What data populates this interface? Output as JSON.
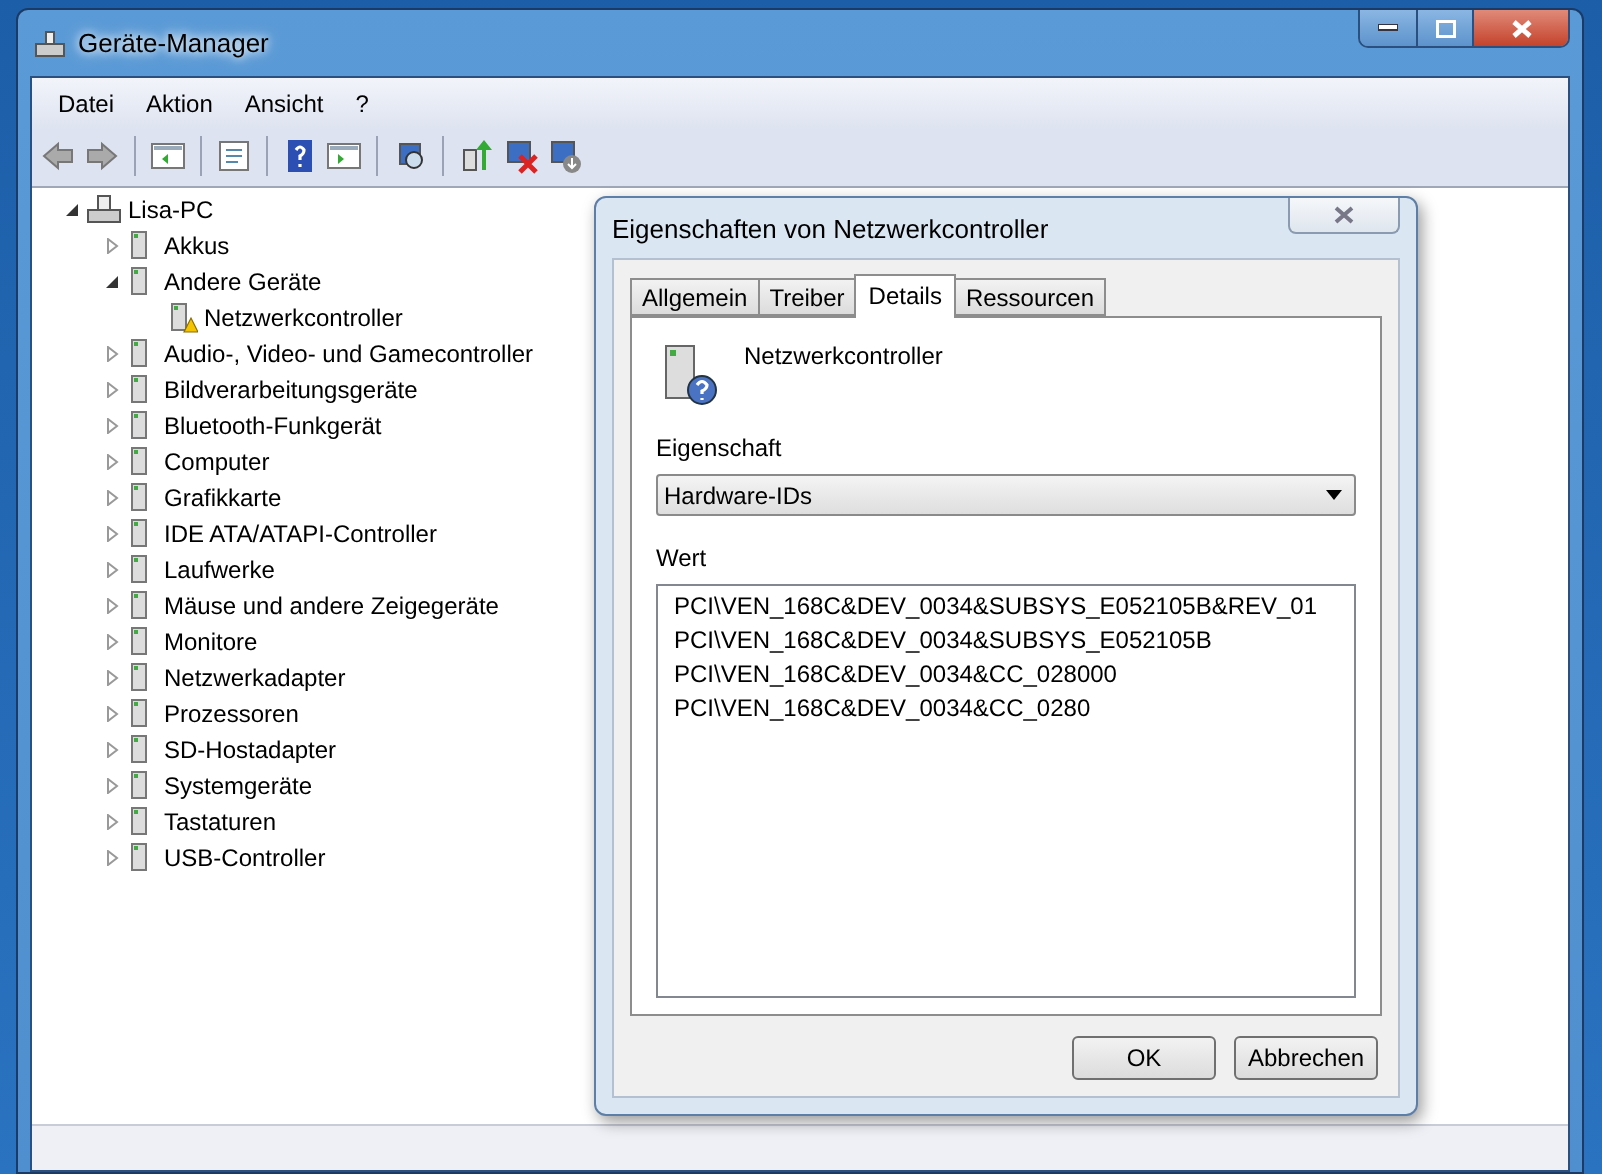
{
  "window": {
    "title": "Geräte-Manager"
  },
  "menu": [
    "Datei",
    "Aktion",
    "Ansicht",
    "?"
  ],
  "tree": {
    "label": "Lisa-PC",
    "expanded": true,
    "children": [
      {
        "label": "Akkus",
        "expanded": false
      },
      {
        "label": "Andere Geräte",
        "expanded": true,
        "children": [
          {
            "label": "Netzwerkcontroller",
            "warning": true
          }
        ]
      },
      {
        "label": "Audio-, Video- und Gamecontroller",
        "expanded": false
      },
      {
        "label": "Bildverarbeitungsgeräte",
        "expanded": false
      },
      {
        "label": "Bluetooth-Funkgerät",
        "expanded": false
      },
      {
        "label": "Computer",
        "expanded": false
      },
      {
        "label": "Grafikkarte",
        "expanded": false
      },
      {
        "label": "IDE ATA/ATAPI-Controller",
        "expanded": false
      },
      {
        "label": "Laufwerke",
        "expanded": false
      },
      {
        "label": "Mäuse und andere Zeigegeräte",
        "expanded": false
      },
      {
        "label": "Monitore",
        "expanded": false
      },
      {
        "label": "Netzwerkadapter",
        "expanded": false
      },
      {
        "label": "Prozessoren",
        "expanded": false
      },
      {
        "label": "SD-Hostadapter",
        "expanded": false
      },
      {
        "label": "Systemgeräte",
        "expanded": false
      },
      {
        "label": "Tastaturen",
        "expanded": false
      },
      {
        "label": "USB-Controller",
        "expanded": false
      }
    ]
  },
  "dialog": {
    "title": "Eigenschaften von Netzwerkcontroller",
    "tabs": [
      {
        "label": "Allgemein",
        "selected": false
      },
      {
        "label": "Treiber",
        "selected": false
      },
      {
        "label": "Details",
        "selected": true
      },
      {
        "label": "Ressourcen",
        "selected": false
      }
    ],
    "device_name": "Netzwerkcontroller",
    "property_label": "Eigenschaft",
    "property_value": "Hardware-IDs",
    "value_label": "Wert",
    "values": [
      "PCI\\VEN_168C&DEV_0034&SUBSYS_E052105B&REV_01",
      "PCI\\VEN_168C&DEV_0034&SUBSYS_E052105B",
      "PCI\\VEN_168C&DEV_0034&CC_028000",
      "PCI\\VEN_168C&DEV_0034&CC_0280"
    ],
    "buttons": [
      "OK",
      "Abbrechen"
    ]
  }
}
